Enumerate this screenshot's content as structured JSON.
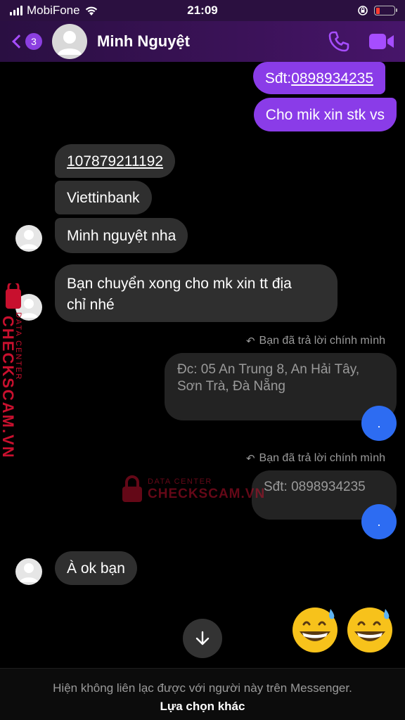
{
  "status_bar": {
    "carrier": "MobiFone",
    "time": "21:09"
  },
  "header": {
    "badge_count": "3",
    "contact_name": "Minh Nguyệt"
  },
  "messages": {
    "out_phone_prefix": "Sđt: ",
    "out_phone_number": "0898934235",
    "out_request": "Cho mik xin stk vs",
    "in_account": "107879211192",
    "in_bank": "Viettinbank",
    "in_name": "Minh nguyệt nha",
    "in_address_request_line1": "Bạn chuyển xong cho mk xin tt địa",
    "in_address_request_line2": "chỉ nhé",
    "reply_label_1": "Bạn đã trả lời chính mình",
    "quoted_address_line1": "Đc: 05 An Trung 8, An Hải Tây,",
    "quoted_address_line2": "Sơn Trà, Đà Nẵng",
    "seen_1": ".",
    "reply_label_2": "Bạn đã trả lời chính mình",
    "quoted_phone": "Sđt: 0898934235",
    "seen_2": ".",
    "in_ok": "À ok bạn"
  },
  "watermark": {
    "line_top": "DATA CENTER",
    "line_bottom": "CHECKSCAM.VN"
  },
  "footer": {
    "note": "Hiện không liên lạc được với người này trên Messenger.",
    "link": "Lựa chọn khác"
  },
  "colors": {
    "accent": "#8a3ce8",
    "incoming_bubble": "#2f2f2f",
    "seen_dot": "#2d6cf2",
    "watermark": "#c8102e"
  }
}
